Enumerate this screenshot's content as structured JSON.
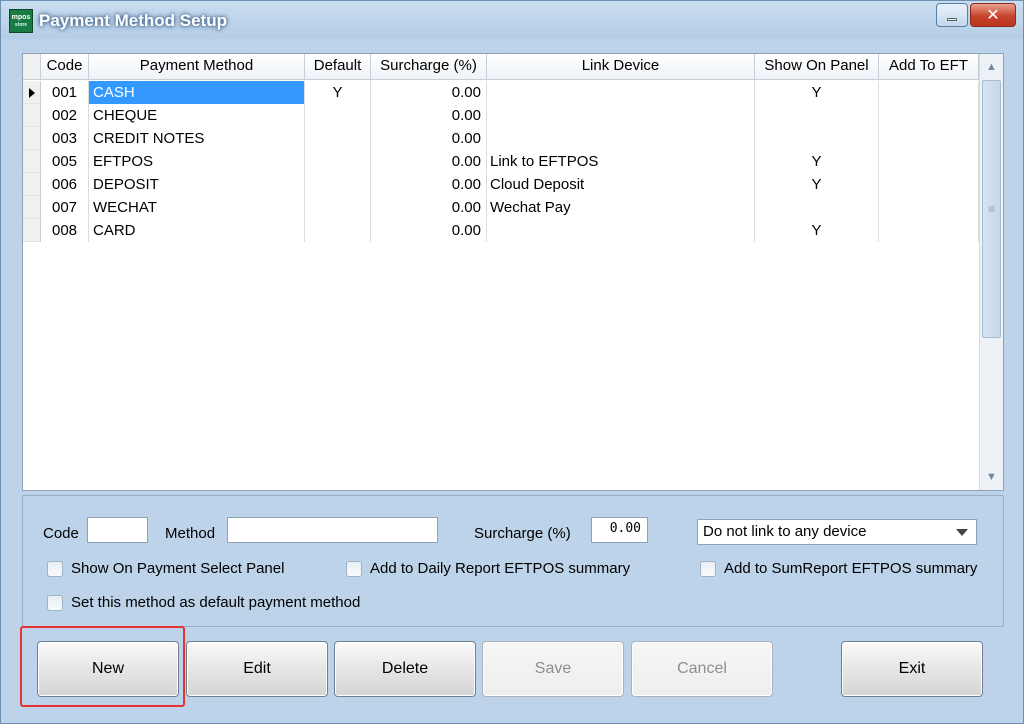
{
  "window": {
    "title": "Payment Method Setup",
    "icon_text": "mpos",
    "icon_subtext": "store",
    "minimize_icon": "minimize-icon",
    "close_icon": "close-icon",
    "close_glyph": "✕"
  },
  "grid": {
    "columns": [
      "Code",
      "Payment Method",
      "Default",
      "Surcharge (%)",
      "Link Device",
      "Show On Panel",
      "Add To EFT"
    ],
    "rows": [
      {
        "code": "001",
        "method": "CASH",
        "default": "Y",
        "surcharge": "0.00",
        "link": "",
        "show": "Y",
        "eft": ""
      },
      {
        "code": "002",
        "method": "CHEQUE",
        "default": "",
        "surcharge": "0.00",
        "link": "",
        "show": "",
        "eft": ""
      },
      {
        "code": "003",
        "method": "CREDIT NOTES",
        "default": "",
        "surcharge": "0.00",
        "link": "",
        "show": "",
        "eft": ""
      },
      {
        "code": "005",
        "method": "EFTPOS",
        "default": "",
        "surcharge": "0.00",
        "link": "Link to EFTPOS",
        "show": "Y",
        "eft": ""
      },
      {
        "code": "006",
        "method": "DEPOSIT",
        "default": "",
        "surcharge": "0.00",
        "link": "Cloud Deposit",
        "show": "Y",
        "eft": ""
      },
      {
        "code": "007",
        "method": "WECHAT",
        "default": "",
        "surcharge": "0.00",
        "link": "Wechat Pay",
        "show": "",
        "eft": ""
      },
      {
        "code": "008",
        "method": "CARD",
        "default": "",
        "surcharge": "0.00",
        "link": "",
        "show": "Y",
        "eft": ""
      }
    ],
    "selected_row": 0
  },
  "form": {
    "code_label": "Code",
    "code_value": "",
    "method_label": "Method",
    "method_value": "",
    "surcharge_label": "Surcharge (%)",
    "surcharge_value": "0.00",
    "link_device_value": "Do not link to any device",
    "chk_show_panel": "Show On Payment Select Panel",
    "chk_daily_report": "Add to Daily Report EFTPOS summary",
    "chk_sum_report": "Add to SumReport EFTPOS summary",
    "chk_default": "Set this method as default payment method"
  },
  "buttons": {
    "new": "New",
    "edit": "Edit",
    "delete": "Delete",
    "save": "Save",
    "cancel": "Cancel",
    "exit": "Exit"
  },
  "colors": {
    "selection": "#3399ff",
    "highlight_border": "#e53333",
    "window_bg": "#bcd3e9"
  }
}
